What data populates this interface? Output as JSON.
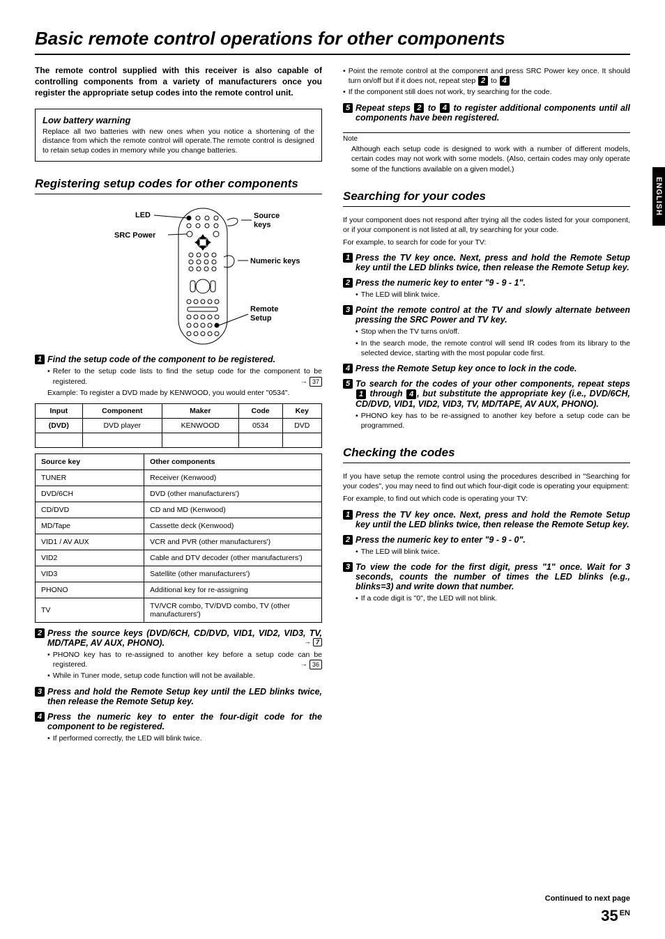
{
  "title": "Basic remote control operations for other components",
  "side_tab": "ENGLISH",
  "intro": "The remote control supplied with this receiver is also capable of controlling components from a variety of manufacturers once you register the appropriate setup codes into the remote control unit.",
  "low_battery": {
    "heading": "Low battery warning",
    "body": "Replace all two batteries with new ones when you notice a shortening of the distance from which the remote control will operate.The remote control is designed to retain setup codes in memory while you change batteries."
  },
  "registering": {
    "heading": "Registering setup codes for other components",
    "remote_labels": {
      "led": "LED",
      "src_power": "SRC Power",
      "source_keys": "Source keys",
      "numeric_keys": "Numeric keys",
      "remote_setup": "Remote Setup"
    },
    "step1": {
      "n": "1",
      "text": "Find the setup code of the component to be registered."
    },
    "s1b1": "Refer to the setup code lists to find the setup code for the component to be registered.",
    "s1_ref": "37",
    "s1b2": "Example: To register a DVD made by KENWOOD, you would enter \"0534\".",
    "codes_table": {
      "headers": [
        "Input",
        "Component",
        "Maker",
        "Code",
        "Key"
      ],
      "row": [
        "(DVD)",
        "DVD player",
        "KENWOOD",
        "0534",
        "DVD"
      ]
    },
    "srckey_table": {
      "headers": [
        "Source key",
        "Other components"
      ],
      "rows": [
        [
          "TUNER",
          "Receiver (Kenwood)"
        ],
        [
          "DVD/6CH",
          "DVD (other manufacturers')"
        ],
        [
          "CD/DVD",
          "CD and MD (Kenwood)"
        ],
        [
          "MD/Tape",
          "Cassette deck (Kenwood)"
        ],
        [
          "VID1 / AV AUX",
          "VCR and PVR (other manufacturers')"
        ],
        [
          "VID2",
          "Cable and DTV decoder (other manufacturers')"
        ],
        [
          "VID3",
          "Satellite (other manufacturers')"
        ],
        [
          "PHONO",
          "Additional key for re-assigning"
        ],
        [
          "TV",
          "TV/VCR combo, TV/DVD combo, TV (other manufacturers')"
        ]
      ]
    },
    "step2": {
      "n": "2",
      "text": "Press the source keys (DVD/6CH, CD/DVD, VID1, VID2, VID3, TV, MD/TAPE, AV AUX, PHONO).",
      "ref": "7"
    },
    "s2b1": "PHONO key has to re-assigned to another key before a setup code can be registered.",
    "s2_ref": "36",
    "s2b2": "While in Tuner mode, setup code function will not be available.",
    "step3": {
      "n": "3",
      "text": "Press and hold the Remote Setup key until the LED blinks twice, then release the Remote Setup key."
    },
    "step4": {
      "n": "4",
      "text": "Press the numeric key to enter the four-digit code for the component to be registered."
    },
    "s4b1": "If performed correctly, the LED will blink twice."
  },
  "col2_top": {
    "b1_pre": "Point the remote control at the component and press SRC Power key once. It should turn on/off but if it does not, repeat step ",
    "b1_n1": "2",
    "b1_mid": " to ",
    "b1_n2": "4",
    "b2": "If the component still does not work, try searching for the code.",
    "step5_n": "5",
    "step5_pre": "Repeat steps ",
    "step5_a": "2",
    "step5_mid": " to ",
    "step5_b": "4",
    "step5_post": " to register additional components until all components have been registered.",
    "note_label": "Note",
    "note_text": "Although each setup code is designed to work with a number of different models, certain codes may not work with some models. (Also, certain codes may only operate some of the functions available on a given model.)"
  },
  "searching": {
    "heading": "Searching for your codes",
    "intro1": "If your component does not respond after trying all the codes listed for your component, or if your component is not listed at all, try searching for your code.",
    "intro2": "For example, to search for code for your TV:",
    "step1": {
      "n": "1",
      "text": "Press the TV key once. Next, press and hold the Remote Setup key until the LED blinks twice, then release the Remote Setup key."
    },
    "step2": {
      "n": "2",
      "text": "Press the numeric key to enter \"9 - 9 - 1\"."
    },
    "s2b1": "The LED will blink twice.",
    "step3": {
      "n": "3",
      "text": "Point the remote control at the TV and slowly alternate between pressing the SRC Power and TV key."
    },
    "s3b1": "Stop when the TV turns on/off.",
    "s3b2": "In the search mode, the remote control will send IR codes from its library to the selected device, starting with the most popular code first.",
    "step4": {
      "n": "4",
      "text": "Press the Remote Setup key once to lock in the code."
    },
    "step5_n": "5",
    "step5_pre": "To search for the codes of your other components, repeat steps ",
    "step5_a": "1",
    "step5_mid": " through ",
    "step5_b": "4",
    "step5_post": ", but substitute the appropriate key (i.e., DVD/6CH, CD/DVD, VID1, VID2, VID3, TV, MD/TAPE, AV AUX, PHONO).",
    "s5b1": "PHONO key has to be re-assigned to another key before a setup code can be programmed."
  },
  "checking": {
    "heading": "Checking the codes",
    "intro1": "If you have setup the remote control using the procedures described in \"Searching for your codes\", you may need to find out which four-digit code is operating your equipment:",
    "intro2": "For example, to find out which code is operating your TV:",
    "step1": {
      "n": "1",
      "text": "Press the TV key once. Next, press and hold the Remote Setup key until the LED blinks twice, then release the Remote Setup key."
    },
    "step2": {
      "n": "2",
      "text": "Press the numeric key to enter \"9 - 9 - 0\"."
    },
    "s2b1": "The LED will blink twice.",
    "step3": {
      "n": "3",
      "text": "To view the code for the first digit, press \"1\" once. Wait for 3 seconds, counts the number of times the LED blinks (e.g., blinks=3) and write down that number."
    },
    "s3b1": "If a code digit is \"0\", the LED will not blink."
  },
  "footer": {
    "continued": "Continued to next page",
    "page": "35",
    "lang": "EN"
  }
}
